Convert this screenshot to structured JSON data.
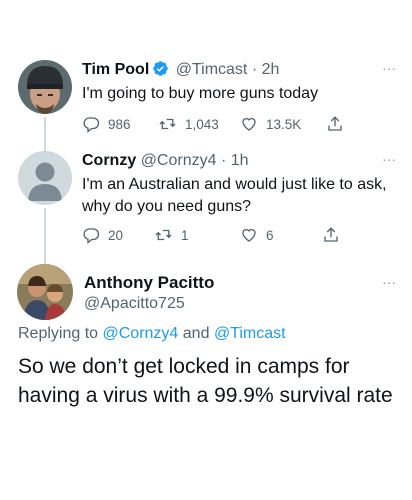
{
  "tweets": [
    {
      "name": "Tim Pool",
      "handle": "@Timcast",
      "separator": "·",
      "time": "2h",
      "text": "I'm going to buy more guns today",
      "replies": "986",
      "retweets": "1,043",
      "likes": "13.5K",
      "verified": true
    },
    {
      "name": "Cornzy",
      "handle": "@Cornzy4",
      "separator": "·",
      "time": "1h",
      "text": "I'm an Australian and would just like to ask, why do you need guns?",
      "replies": "20",
      "retweets": "1",
      "likes": "6"
    }
  ],
  "main_tweet": {
    "name": "Anthony Pacitto",
    "handle": "@Apacitto725",
    "replying_prefix": "Replying to",
    "replying_user1": "@Cornzy4",
    "replying_and": "and",
    "replying_user2": "@Timcast",
    "text": "So we don’t get locked in camps for having a virus with a 99.9% survival rate"
  },
  "more_label": "···",
  "colors": {
    "accent": "#1d9bf0",
    "muted": "#536471",
    "line": "#cfd9de"
  }
}
